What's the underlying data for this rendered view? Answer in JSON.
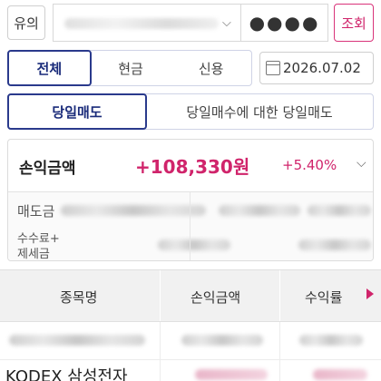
{
  "account": {
    "type_button": "유의",
    "password_mask": "●●●●",
    "query_button": "조회"
  },
  "type_tabs": [
    "전체",
    "현금",
    "신용"
  ],
  "date": "2026.07.02",
  "sell_tabs": [
    "당일매도",
    "당일매수에 대한 당일매도"
  ],
  "summary": {
    "pl_label": "손익금액",
    "pl_amount": "+108,330원",
    "pl_rate": "+5.40%",
    "sell_label": "매도금",
    "fee_label_1": "수수료+",
    "fee_label_2": "제세금"
  },
  "table": {
    "headers": [
      "종목명",
      "손익금액",
      "수익률"
    ],
    "rows": [
      {
        "name": ""
      },
      {
        "name": "KODEX 삼성전자"
      }
    ]
  },
  "colors": {
    "accent": "#d0246b",
    "active_tab": "#2a3a8c"
  },
  "icons": [
    "chevron-down-icon",
    "calendar-icon",
    "chevron-down-icon",
    "triangle-right-icon"
  ]
}
